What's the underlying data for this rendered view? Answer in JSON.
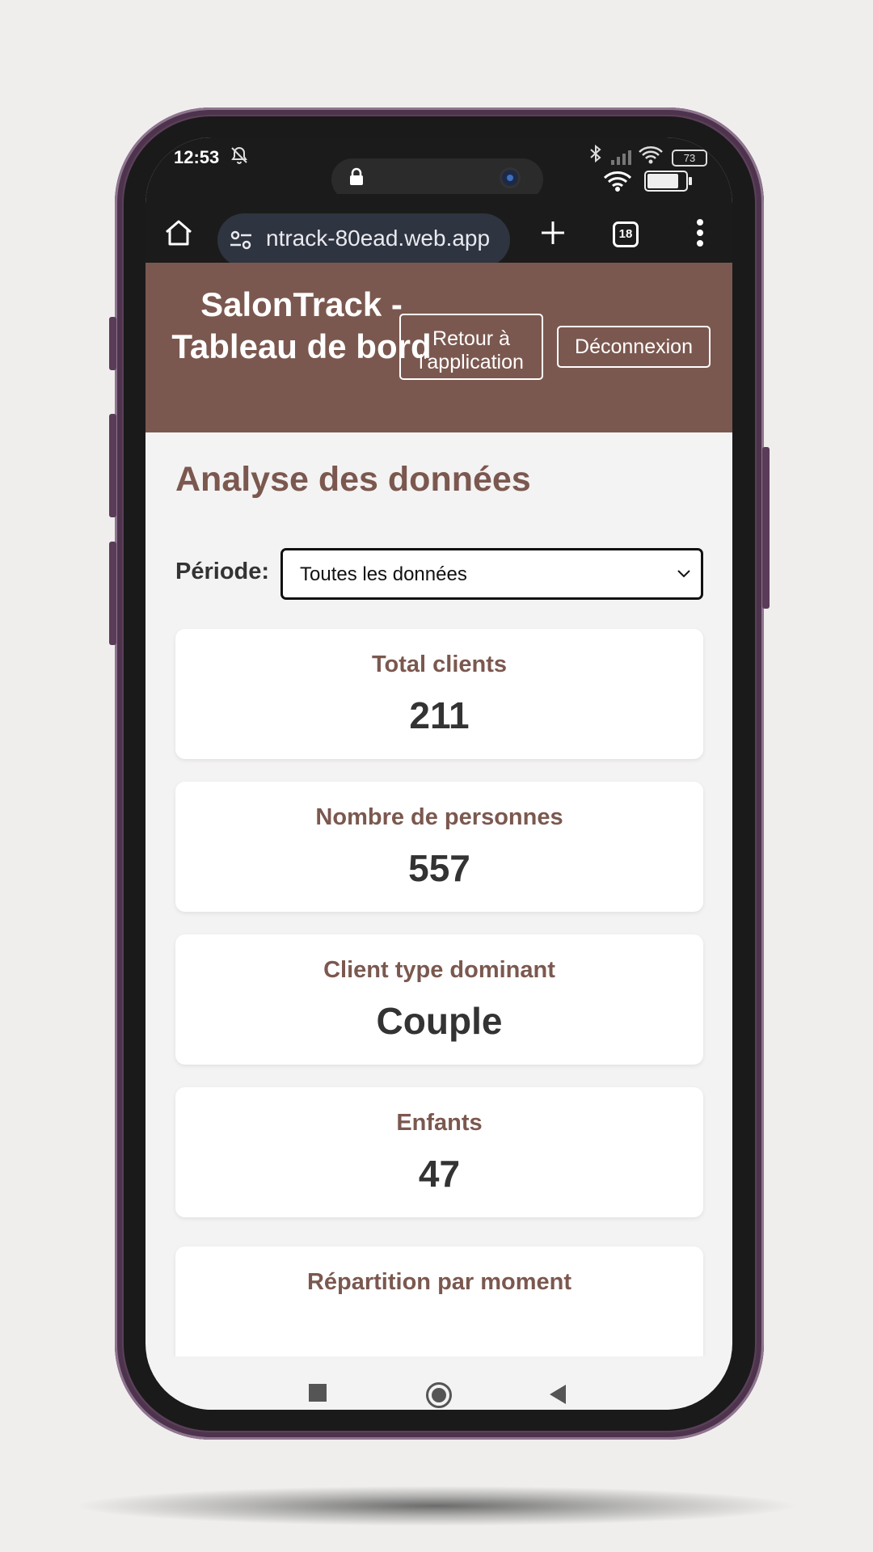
{
  "status_bar": {
    "time": "12:53",
    "battery": "73"
  },
  "browser": {
    "url": "ntrack-80ead.web.app",
    "tab_count": "18"
  },
  "app_header": {
    "title": "SalonTrack - Tableau de bord",
    "back_button": "Retour à l'application",
    "logout_button": "Déconnexion",
    "brand_color": "#7b584f"
  },
  "main": {
    "heading": "Analyse des données",
    "period_label": "Période:",
    "period_selected": "Toutes les données",
    "stats": [
      {
        "label": "Total clients",
        "value": "211"
      },
      {
        "label": "Nombre de personnes",
        "value": "557"
      },
      {
        "label": "Client type dominant",
        "value": "Couple"
      },
      {
        "label": "Enfants",
        "value": "47"
      }
    ],
    "section_card_title": "Répartition par moment"
  },
  "icons": [
    "bell-off-icon",
    "lock-icon",
    "bluetooth-icon",
    "signal-icon",
    "wifi-icon",
    "battery-icon",
    "home-icon",
    "site-settings-icon",
    "new-tab-icon",
    "tabs-icon",
    "more-menu-icon",
    "chevron-down-icon",
    "recents-icon",
    "home-nav-icon",
    "back-nav-icon"
  ]
}
